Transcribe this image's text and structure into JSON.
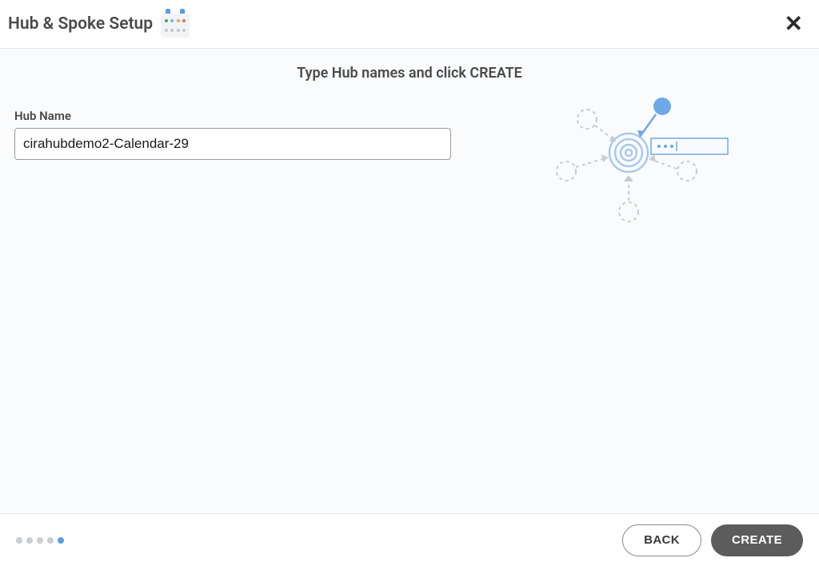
{
  "header": {
    "title": "Hub & Spoke Setup"
  },
  "main": {
    "instruction": "Type Hub names and click CREATE",
    "hubName": {
      "label": "Hub Name",
      "value": "cirahubdemo2-Calendar-29"
    }
  },
  "footer": {
    "steps": {
      "total": 5,
      "current": 5
    },
    "buttons": {
      "back": "BACK",
      "create": "CREATE"
    }
  }
}
